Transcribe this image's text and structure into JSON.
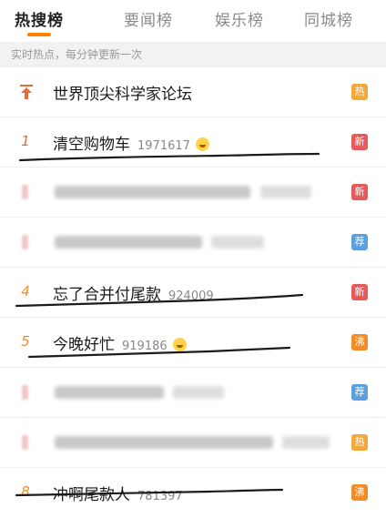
{
  "tabs": [
    "热搜榜",
    "要闻榜",
    "娱乐榜",
    "同城榜"
  ],
  "subheader": "实时热点，每分钟更新一次",
  "rows": [
    {
      "rank": "",
      "title": "世界顶尖科学家论坛",
      "count": "",
      "badge": "热",
      "badge_color": "#f3a83a"
    },
    {
      "rank": "1",
      "title": "清空购物车",
      "count": "1971617",
      "badge": "新",
      "badge_color": "#e8595a"
    },
    {
      "rank": "",
      "title": "",
      "count": "",
      "badge": "新",
      "badge_color": "#e8595a"
    },
    {
      "rank": "",
      "title": "",
      "count": "",
      "badge": "荐",
      "badge_color": "#5aa0e0"
    },
    {
      "rank": "4",
      "title": "忘了合并付尾款",
      "count": "924009",
      "badge": "新",
      "badge_color": "#e8595a"
    },
    {
      "rank": "5",
      "title": "今晚好忙",
      "count": "919186",
      "badge": "沸",
      "badge_color": "#f28c28"
    },
    {
      "rank": "",
      "title": "",
      "count": "",
      "badge": "荐",
      "badge_color": "#5aa0e0"
    },
    {
      "rank": "",
      "title": "",
      "count": "",
      "badge": "热",
      "badge_color": "#f3a83a"
    },
    {
      "rank": "8",
      "title": "冲啊尾款人",
      "count": "781397",
      "badge": "沸",
      "badge_color": "#f28c28"
    }
  ],
  "icons": {
    "top_pin": "arrow-up-pin-icon",
    "laugh": "laughing-emoji-icon"
  }
}
